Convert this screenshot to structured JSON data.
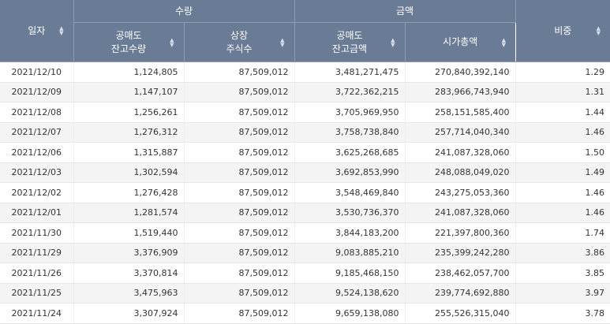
{
  "header": {
    "date_label": "일자",
    "group_qty": "수량",
    "group_amt": "금액",
    "ratio_label": "비중",
    "short_qty_l1": "공매도",
    "short_qty_l2": "잔고수량",
    "listed_l1": "상장",
    "listed_l2": "주식수",
    "short_amt_l1": "공매도",
    "short_amt_l2": "잔고금액",
    "mcap_label": "시가총액"
  },
  "rows": [
    {
      "date": "2021/12/10",
      "short_qty": "1,124,805",
      "listed": "87,509,012",
      "short_amt": "3,481,271,475",
      "mcap": "270,840,392,140",
      "ratio": "1.29"
    },
    {
      "date": "2021/12/09",
      "short_qty": "1,147,107",
      "listed": "87,509,012",
      "short_amt": "3,722,362,215",
      "mcap": "283,966,743,940",
      "ratio": "1.31"
    },
    {
      "date": "2021/12/08",
      "short_qty": "1,256,261",
      "listed": "87,509,012",
      "short_amt": "3,705,969,950",
      "mcap": "258,151,585,400",
      "ratio": "1.44"
    },
    {
      "date": "2021/12/07",
      "short_qty": "1,276,312",
      "listed": "87,509,012",
      "short_amt": "3,758,738,840",
      "mcap": "257,714,040,340",
      "ratio": "1.46"
    },
    {
      "date": "2021/12/06",
      "short_qty": "1,315,887",
      "listed": "87,509,012",
      "short_amt": "3,625,268,685",
      "mcap": "241,087,328,060",
      "ratio": "1.50"
    },
    {
      "date": "2021/12/03",
      "short_qty": "1,302,594",
      "listed": "87,509,012",
      "short_amt": "3,692,853,990",
      "mcap": "248,088,049,020",
      "ratio": "1.49"
    },
    {
      "date": "2021/12/02",
      "short_qty": "1,276,428",
      "listed": "87,509,012",
      "short_amt": "3,548,469,840",
      "mcap": "243,275,053,360",
      "ratio": "1.46"
    },
    {
      "date": "2021/12/01",
      "short_qty": "1,281,574",
      "listed": "87,509,012",
      "short_amt": "3,530,736,370",
      "mcap": "241,087,328,060",
      "ratio": "1.46"
    },
    {
      "date": "2021/11/30",
      "short_qty": "1,519,440",
      "listed": "87,509,012",
      "short_amt": "3,844,183,200",
      "mcap": "221,397,800,360",
      "ratio": "1.74"
    },
    {
      "date": "2021/11/29",
      "short_qty": "3,376,909",
      "listed": "87,509,012",
      "short_amt": "9,083,885,210",
      "mcap": "235,399,242,280",
      "ratio": "3.86"
    },
    {
      "date": "2021/11/26",
      "short_qty": "3,370,814",
      "listed": "87,509,012",
      "short_amt": "9,185,468,150",
      "mcap": "238,462,057,700",
      "ratio": "3.85"
    },
    {
      "date": "2021/11/25",
      "short_qty": "3,475,963",
      "listed": "87,509,012",
      "short_amt": "9,524,138,620",
      "mcap": "239,774,692,880",
      "ratio": "3.97"
    },
    {
      "date": "2021/11/24",
      "short_qty": "3,307,924",
      "listed": "87,509,012",
      "short_amt": "9,659,138,080",
      "mcap": "255,526,315,040",
      "ratio": "3.78"
    }
  ]
}
